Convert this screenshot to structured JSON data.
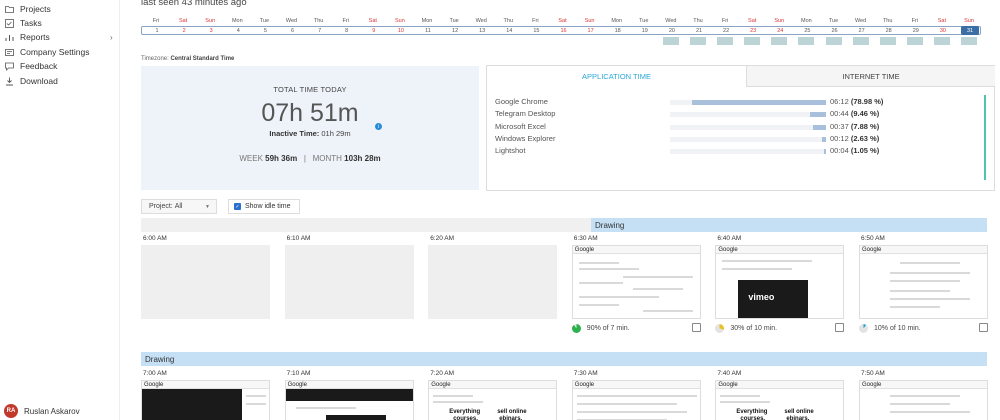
{
  "sidebar": {
    "items": [
      {
        "label": "Projects",
        "icon": "folder-icon"
      },
      {
        "label": "Tasks",
        "icon": "tasks-icon"
      },
      {
        "label": "Reports",
        "icon": "reports-icon",
        "expandable": true
      },
      {
        "label": "Company Settings",
        "icon": "settings-icon"
      },
      {
        "label": "Feedback",
        "icon": "feedback-icon"
      },
      {
        "label": "Download",
        "icon": "download-icon"
      }
    ],
    "user": {
      "initials": "RA",
      "name": "Ruslan Askarov",
      "avatar_color": "#c0392b"
    }
  },
  "header": {
    "last_seen": "last seen 43 minutes ago"
  },
  "calendar": {
    "days": [
      {
        "dow": "Fri",
        "num": "1"
      },
      {
        "dow": "Sat",
        "num": "2"
      },
      {
        "dow": "Sun",
        "num": "3"
      },
      {
        "dow": "Mon",
        "num": "4"
      },
      {
        "dow": "Tue",
        "num": "5"
      },
      {
        "dow": "Wed",
        "num": "6"
      },
      {
        "dow": "Thu",
        "num": "7"
      },
      {
        "dow": "Fri",
        "num": "8"
      },
      {
        "dow": "Sat",
        "num": "9"
      },
      {
        "dow": "Sun",
        "num": "10"
      },
      {
        "dow": "Mon",
        "num": "11"
      },
      {
        "dow": "Tue",
        "num": "12"
      },
      {
        "dow": "Wed",
        "num": "13"
      },
      {
        "dow": "Thu",
        "num": "14"
      },
      {
        "dow": "Fri",
        "num": "15"
      },
      {
        "dow": "Sat",
        "num": "16"
      },
      {
        "dow": "Sun",
        "num": "17"
      },
      {
        "dow": "Mon",
        "num": "18"
      },
      {
        "dow": "Tue",
        "num": "19"
      },
      {
        "dow": "Wed",
        "num": "20"
      },
      {
        "dow": "Thu",
        "num": "21"
      },
      {
        "dow": "Fri",
        "num": "22"
      },
      {
        "dow": "Sat",
        "num": "23"
      },
      {
        "dow": "Sun",
        "num": "24"
      },
      {
        "dow": "Mon",
        "num": "25"
      },
      {
        "dow": "Tue",
        "num": "26"
      },
      {
        "dow": "Wed",
        "num": "27"
      },
      {
        "dow": "Thu",
        "num": "28"
      },
      {
        "dow": "Fri",
        "num": "29"
      },
      {
        "dow": "Sat",
        "num": "30"
      },
      {
        "dow": "Sun",
        "num": "31"
      }
    ],
    "selected": "31",
    "active_days": [
      "20",
      "21",
      "22",
      "23",
      "24",
      "25",
      "26",
      "27",
      "28",
      "29",
      "30",
      "31"
    ]
  },
  "timezone": {
    "label": "Timezone:",
    "value": "Central Standard Time"
  },
  "total": {
    "title": "TOTAL TIME TODAY",
    "time": "07h 51m",
    "inactive_label": "Inactive Time:",
    "inactive_value": "01h 29m",
    "week_label": "WEEK",
    "week_value": "59h 36m",
    "separator": "|",
    "month_label": "MONTH",
    "month_value": "103h 28m"
  },
  "app_panel": {
    "tabs": [
      "APPLICATION TIME",
      "INTERNET TIME"
    ],
    "apps": [
      {
        "name": "Google Chrome",
        "time": "06:12",
        "pct": "(78.98 %)",
        "fraction": 0.7898
      },
      {
        "name": "Telegram Desktop",
        "time": "00:44",
        "pct": "(9.46 %)",
        "fraction": 0.0946
      },
      {
        "name": "Microsoft Excel",
        "time": "00:37",
        "pct": "(7.88 %)",
        "fraction": 0.0788
      },
      {
        "name": "Windows Explorer",
        "time": "00:12",
        "pct": "(2.63 %)",
        "fraction": 0.0263
      },
      {
        "name": "Lightshot",
        "time": "00:04",
        "pct": "(1.05 %)",
        "fraction": 0.0105
      }
    ]
  },
  "filters": {
    "project_label": "Project:",
    "project_value": "All",
    "idle_label": "Show idle time"
  },
  "timeline": {
    "row1_band": "Drawing",
    "row1": [
      {
        "time": "6:00 AM",
        "empty": true
      },
      {
        "time": "6:10 AM",
        "empty": true
      },
      {
        "time": "6:20 AM",
        "empty": true
      },
      {
        "time": "6:30 AM",
        "empty": false,
        "browser": "Google",
        "activity": "90% of 7 min.",
        "pie": 0.9,
        "pie_color": "#2bb24c"
      },
      {
        "time": "6:40 AM",
        "empty": false,
        "browser": "Google",
        "activity": "30% of 10 min.",
        "pie": 0.3,
        "pie_color": "#e6c229"
      },
      {
        "time": "6:50 AM",
        "empty": false,
        "browser": "Google",
        "activity": "10% of 10 min.",
        "pie": 0.1,
        "pie_color": "#2aa7d9"
      }
    ],
    "row2_band": "Drawing",
    "row2": [
      {
        "time": "7:00 AM",
        "browser": "Google"
      },
      {
        "time": "7:10 AM",
        "browser": "Google"
      },
      {
        "time": "7:20 AM",
        "browser": "Google"
      },
      {
        "time": "7:30 AM",
        "browser": "Google"
      },
      {
        "time": "7:40 AM",
        "browser": "Google"
      },
      {
        "time": "7:50 AM",
        "browser": "Google"
      }
    ]
  },
  "thumb_texts": {
    "vimeo": "vimeo",
    "everything": "Everything",
    "courses": "courses.",
    "sell_online": "sell online",
    "webinars": "ebinars."
  },
  "colors": {
    "accent": "#2aa7d9",
    "band": "#c5e0f5",
    "calendar_selected": "#3a6ea5",
    "activity_bar": "#a8c0dc"
  }
}
